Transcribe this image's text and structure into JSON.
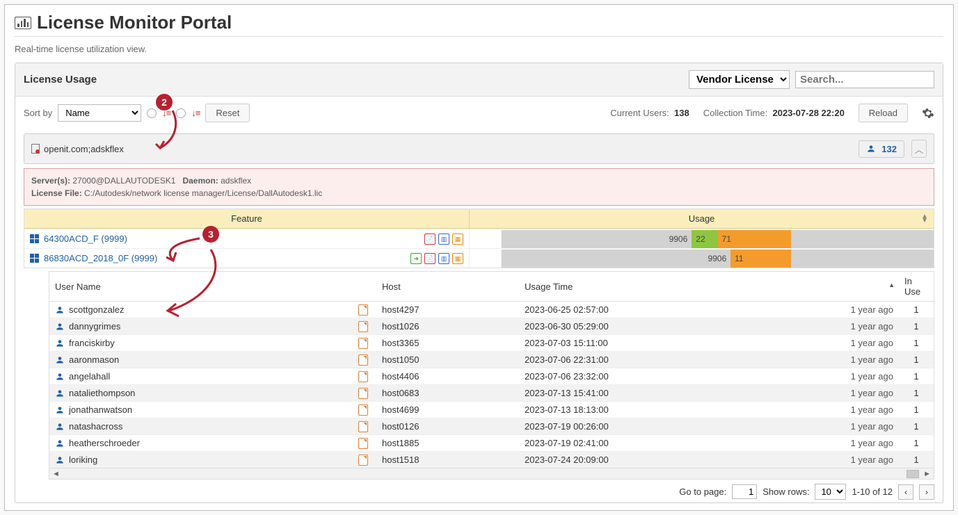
{
  "page": {
    "title": "License Monitor Portal",
    "subtitle": "Real-time license utilization view."
  },
  "panel": {
    "title": "License Usage",
    "license_type_select": "Vendor License",
    "search_placeholder": "Search..."
  },
  "toolbar": {
    "sort_label": "Sort by",
    "sort_field": "Name",
    "reset_label": "Reset",
    "current_users_label": "Current Users:",
    "current_users_value": "138",
    "collection_time_label": "Collection Time:",
    "collection_time_value": "2023-07-28 22:20",
    "reload_label": "Reload"
  },
  "server": {
    "name": "openit.com;adskflex",
    "user_count": "132",
    "servers_label": "Server(s):",
    "servers_value": "27000@DALLAUTODESK1",
    "daemon_label": "Daemon:",
    "daemon_value": "adskflex",
    "license_file_label": "License File:",
    "license_file_value": "C:/Autodesk/network license manager/License/DallAutodesk1.lic"
  },
  "columns": {
    "feature": "Feature",
    "usage": "Usage"
  },
  "features": [
    {
      "name": "64300ACD_F (9999)",
      "bar_total_label": "9906",
      "segments": [
        {
          "label": "22",
          "width_pct": 6,
          "color": "#8ec641"
        },
        {
          "label": "71",
          "width_pct": 17,
          "color": "#f39c2c"
        }
      ],
      "extra_icons": [
        "doc",
        "chart",
        "table"
      ]
    },
    {
      "name": "86830ACD_2018_0F (9999)",
      "bar_total_label": "9906",
      "segments": [
        {
          "label": "11",
          "width_pct": 14,
          "color": "#f39c2c"
        }
      ],
      "extra_icons": [
        "export",
        "doc",
        "chart",
        "table"
      ]
    }
  ],
  "user_columns": {
    "user": "User Name",
    "host": "Host",
    "usage_time": "Usage Time",
    "in_use": "In Use"
  },
  "users": [
    {
      "user": "scottgonzalez",
      "host": "host4297",
      "time": "2023-06-25 02:57:00",
      "ago": "1 year ago",
      "in_use": "1"
    },
    {
      "user": "dannygrimes",
      "host": "host1026",
      "time": "2023-06-30 05:29:00",
      "ago": "1 year ago",
      "in_use": "1"
    },
    {
      "user": "franciskirby",
      "host": "host3365",
      "time": "2023-07-03 15:11:00",
      "ago": "1 year ago",
      "in_use": "1"
    },
    {
      "user": "aaronmason",
      "host": "host1050",
      "time": "2023-07-06 22:31:00",
      "ago": "1 year ago",
      "in_use": "1"
    },
    {
      "user": "angelahall",
      "host": "host4406",
      "time": "2023-07-06 23:32:00",
      "ago": "1 year ago",
      "in_use": "1"
    },
    {
      "user": "nataliethompson",
      "host": "host0683",
      "time": "2023-07-13 15:41:00",
      "ago": "1 year ago",
      "in_use": "1"
    },
    {
      "user": "jonathanwatson",
      "host": "host4699",
      "time": "2023-07-13 18:13:00",
      "ago": "1 year ago",
      "in_use": "1"
    },
    {
      "user": "natashacross",
      "host": "host0126",
      "time": "2023-07-19 00:26:00",
      "ago": "1 year ago",
      "in_use": "1"
    },
    {
      "user": "heatherschroeder",
      "host": "host1885",
      "time": "2023-07-19 02:41:00",
      "ago": "1 year ago",
      "in_use": "1"
    },
    {
      "user": "loriking",
      "host": "host1518",
      "time": "2023-07-24 20:09:00",
      "ago": "1 year ago",
      "in_use": "1"
    }
  ],
  "pager": {
    "goto_label": "Go to page:",
    "goto_value": "1",
    "show_rows_label": "Show rows:",
    "show_rows_value": "10",
    "range": "1-10 of 12"
  },
  "annotations": {
    "n2": "2",
    "n3": "3"
  }
}
